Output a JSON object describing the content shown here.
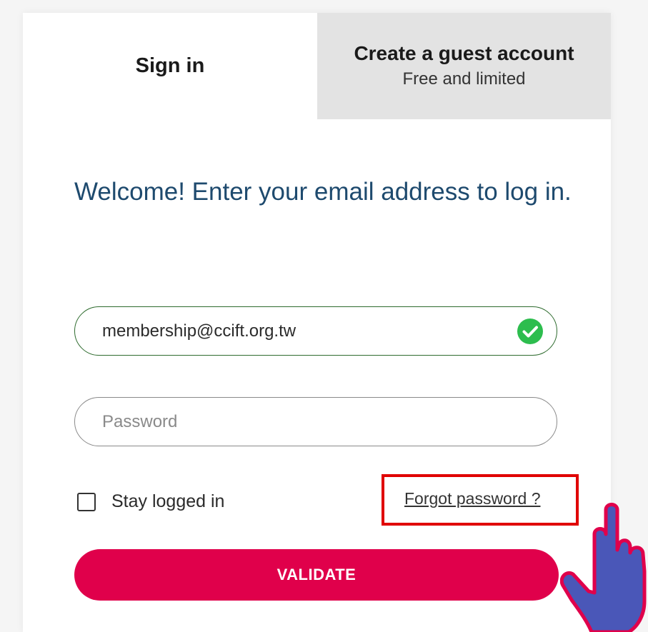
{
  "tabs": {
    "signin_label": "Sign in",
    "guest_title": "Create a guest account",
    "guest_subtitle": "Free and limited"
  },
  "form": {
    "welcome": "Welcome! Enter your email address to log in.",
    "email_value": "membership@ccift.org.tw",
    "password_placeholder": "Password",
    "stay_logged_in_label": "Stay logged in",
    "stay_logged_in_checked": false,
    "forgot_password_label": "Forgot password ?",
    "validate_label": "VALIDATE"
  },
  "icons": {
    "email_valid": "check-circle-icon",
    "pointer": "pointing-hand-icon"
  },
  "colors": {
    "accent": "#e0004b",
    "heading": "#1e4a6e",
    "valid_green": "#2dbd4e",
    "highlight_red": "#e00000",
    "hand_fill": "#4a57b8",
    "hand_outline": "#e0004b",
    "guest_tab_bg": "#e3e3e3"
  }
}
